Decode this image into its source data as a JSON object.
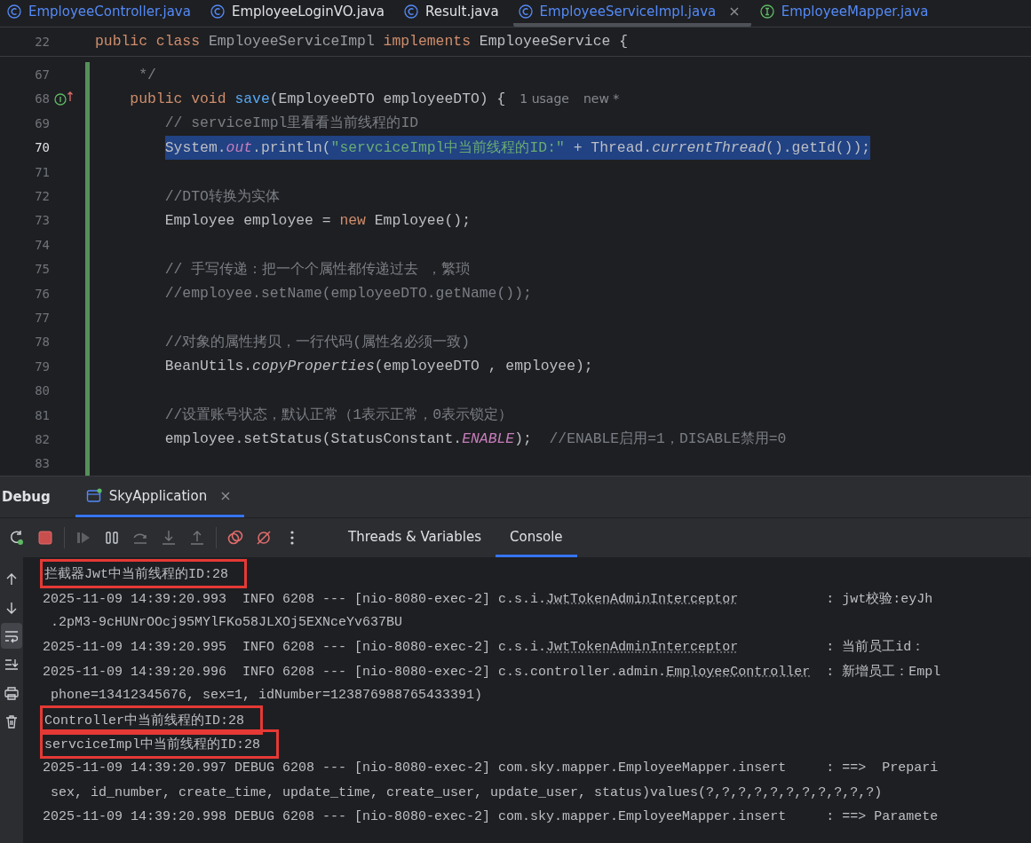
{
  "editor_tabs": [
    {
      "label": "EmployeeController.java",
      "kind": "class",
      "color": "#548af7",
      "selected": false
    },
    {
      "label": "EmployeeLoginVO.java",
      "kind": "class",
      "color": "#dfe1e5",
      "selected": false
    },
    {
      "label": "Result.java",
      "kind": "class",
      "color": "#dfe1e5",
      "selected": false
    },
    {
      "label": "EmployeeServiceImpl.java",
      "kind": "class",
      "color": "#548af7",
      "selected": true,
      "close": "×"
    },
    {
      "label": "EmployeeMapper.java",
      "kind": "interface",
      "color": "#548af7",
      "selected": false
    }
  ],
  "sticky_line": {
    "number": "22",
    "tokens": [
      {
        "text": "public class ",
        "kind": "kw"
      },
      {
        "text": "EmployeeServiceImpl",
        "kind": "dim"
      },
      {
        "text": " implements ",
        "kind": "kw"
      },
      {
        "text": "EmployeeService {",
        "kind": "plain"
      }
    ]
  },
  "code_lines": [
    {
      "number": "67",
      "changed": true,
      "selected": false,
      "tokens": [
        {
          "text": "     */",
          "kind": "comment"
        }
      ]
    },
    {
      "number": "68",
      "changed": true,
      "selected": false,
      "gutter": {
        "kind": "implements"
      },
      "tokens": [
        {
          "text": "    public void ",
          "kind": "kw"
        },
        {
          "text": "save",
          "kind": "fn"
        },
        {
          "text": "(EmployeeDTO employeeDTO) {",
          "kind": "plain"
        }
      ],
      "hints": [
        "1 usage",
        "new *"
      ]
    },
    {
      "number": "69",
      "changed": true,
      "selected": false,
      "tokens": [
        {
          "text": "        // serviceImpl里看看当前线程的ID",
          "kind": "comment"
        }
      ]
    },
    {
      "number": "70",
      "changed": true,
      "selected": true,
      "tokens": [
        {
          "text": "        System.",
          "kind": "plain"
        },
        {
          "text": "out",
          "kind": "field"
        },
        {
          "text": ".println(",
          "kind": "plain"
        },
        {
          "text": "\"servciceImpl中当前线程的ID:\"",
          "kind": "str"
        },
        {
          "text": " + Thread.",
          "kind": "plain"
        },
        {
          "text": "currentThread",
          "kind": "static"
        },
        {
          "text": "().getId());",
          "kind": "plain"
        }
      ]
    },
    {
      "number": "71",
      "changed": true,
      "selected": false
    },
    {
      "number": "72",
      "changed": true,
      "selected": false,
      "tokens": [
        {
          "text": "        //DTO转换为实体",
          "kind": "comment"
        }
      ]
    },
    {
      "number": "73",
      "changed": true,
      "selected": false,
      "tokens": [
        {
          "text": "        Employee employee = ",
          "kind": "plain"
        },
        {
          "text": "new ",
          "kind": "kw"
        },
        {
          "text": "Employee();",
          "kind": "plain"
        }
      ]
    },
    {
      "number": "74",
      "changed": true,
      "selected": false
    },
    {
      "number": "75",
      "changed": true,
      "selected": false,
      "tokens": [
        {
          "text": "        // 手写传递：把一个个属性都传递过去 ，繁琐",
          "kind": "comment"
        }
      ]
    },
    {
      "number": "76",
      "changed": true,
      "selected": false,
      "tokens": [
        {
          "text": "        //employee.setName(employeeDTO.getName());",
          "kind": "comment"
        }
      ]
    },
    {
      "number": "77",
      "changed": true,
      "selected": false
    },
    {
      "number": "78",
      "changed": true,
      "selected": false,
      "tokens": [
        {
          "text": "        //对象的属性拷贝，一行代码(属性名必须一致)",
          "kind": "comment"
        }
      ]
    },
    {
      "number": "79",
      "changed": true,
      "selected": false,
      "tokens": [
        {
          "text": "        BeanUtils.",
          "kind": "plain"
        },
        {
          "text": "copyProperties",
          "kind": "static"
        },
        {
          "text": "(employeeDTO , employee);",
          "kind": "plain"
        }
      ]
    },
    {
      "number": "80",
      "changed": true,
      "selected": false
    },
    {
      "number": "81",
      "changed": true,
      "selected": false,
      "tokens": [
        {
          "text": "        //设置账号状态，默认正常（1表示正常，0表示锁定）",
          "kind": "comment"
        }
      ]
    },
    {
      "number": "82",
      "changed": true,
      "selected": false,
      "tokens": [
        {
          "text": "        employee.setStatus(StatusConstant.",
          "kind": "plain"
        },
        {
          "text": "ENABLE",
          "kind": "field"
        },
        {
          "text": ");  ",
          "kind": "plain"
        },
        {
          "text": "//ENABLE启用=1，DISABLE禁用=0",
          "kind": "comment"
        }
      ]
    },
    {
      "number": "83",
      "changed": true,
      "selected": false
    }
  ],
  "debug": {
    "title": "Debug",
    "session_tab": {
      "label": "SkyApplication",
      "close": "×",
      "selected": true
    },
    "toolbar": [
      {
        "kind": "rerun",
        "disabled": false
      },
      {
        "kind": "stop",
        "disabled": false
      },
      {
        "kind": "sep"
      },
      {
        "kind": "resume",
        "disabled": true
      },
      {
        "kind": "pause",
        "disabled": false
      },
      {
        "kind": "step-over",
        "disabled": true
      },
      {
        "kind": "step-into",
        "disabled": true
      },
      {
        "kind": "step-out",
        "disabled": true
      },
      {
        "kind": "sep"
      },
      {
        "kind": "breakpoints",
        "disabled": false
      },
      {
        "kind": "mute",
        "disabled": false
      },
      {
        "kind": "more",
        "disabled": false
      }
    ],
    "tabs": [
      {
        "label": "Threads & Variables",
        "selected": false
      },
      {
        "label": "Console",
        "selected": true
      }
    ],
    "side_tools": [
      {
        "kind": "up",
        "selected": false
      },
      {
        "kind": "down",
        "selected": false
      },
      {
        "kind": "wrap",
        "selected": true
      },
      {
        "kind": "scroll-end",
        "selected": false
      },
      {
        "kind": "print",
        "selected": false
      },
      {
        "kind": "trash",
        "selected": false
      }
    ],
    "console_lines": [
      {
        "highlighted": true,
        "parts": [
          {
            "text": "拦截器Jwt中当前线程的ID:28",
            "underlined": false
          }
        ]
      },
      {
        "highlighted": false,
        "parts": [
          {
            "text": "2025-11-09 14:39:20.993  INFO 6208 --- [nio-8080-exec-2] c.s.i.",
            "underlined": false
          },
          {
            "text": "JwtTokenAdminInterceptor",
            "underlined": true
          },
          {
            "text": "           : jwt校验:eyJh",
            "underlined": false
          }
        ]
      },
      {
        "highlighted": false,
        "parts": [
          {
            "text": " .2pM3-9cHUNrOOcj95MYlFKo58JLXOj5EXNceYv637BU",
            "underlined": false
          }
        ]
      },
      {
        "highlighted": false,
        "parts": [
          {
            "text": "2025-11-09 14:39:20.995  INFO 6208 --- [nio-8080-exec-2] c.s.i.",
            "underlined": false
          },
          {
            "text": "JwtTokenAdminInterceptor",
            "underlined": true
          },
          {
            "text": "           : 当前员工id：",
            "underlined": false
          }
        ]
      },
      {
        "highlighted": false,
        "parts": [
          {
            "text": "2025-11-09 14:39:20.996  INFO 6208 --- [nio-8080-exec-2] c.s.controller.admin.",
            "underlined": false
          },
          {
            "text": "EmployeeController",
            "underlined": true
          },
          {
            "text": "  : 新增员工：Empl",
            "underlined": false
          }
        ]
      },
      {
        "highlighted": false,
        "parts": [
          {
            "text": " phone=13412345676, sex=1, idNumber=123876988765433391)",
            "underlined": false
          }
        ]
      },
      {
        "highlighted": true,
        "parts": [
          {
            "text": "Controller中当前线程的ID:28",
            "underlined": false
          }
        ]
      },
      {
        "highlighted": true,
        "parts": [
          {
            "text": "servciceImpl中当前线程的ID:28",
            "underlined": false
          }
        ]
      },
      {
        "highlighted": false,
        "parts": [
          {
            "text": "2025-11-09 14:39:20.997 DEBUG 6208 --- [nio-8080-exec-2] com.sky.mapper.EmployeeMapper.insert     : ==>  Prepari",
            "underlined": false
          }
        ]
      },
      {
        "highlighted": false,
        "parts": [
          {
            "text": " sex, id_number, create_time, update_time, create_user, update_user, status)values(?,?,?,?,?,?,?,?,?,?,?)",
            "underlined": false
          }
        ]
      },
      {
        "highlighted": false,
        "parts": [
          {
            "text": "2025-11-09 14:39:20.998 DEBUG 6208 --- [nio-8080-exec-2] com.sky.mapper.EmployeeMapper.insert     : ==> Paramete",
            "underlined": false
          }
        ]
      }
    ]
  }
}
